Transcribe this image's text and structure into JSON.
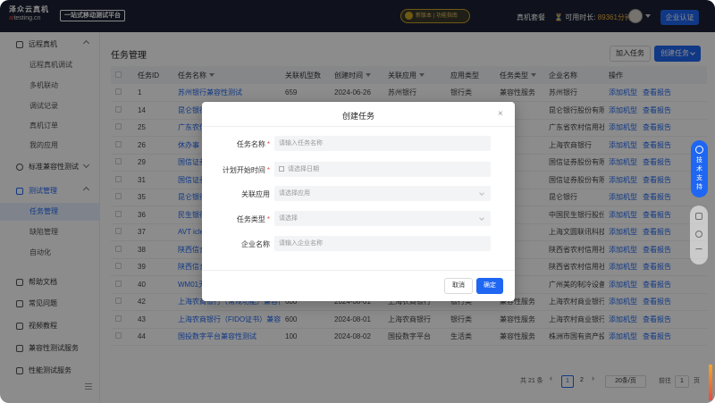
{
  "header": {
    "logo_line1": "泽众云真机",
    "logo_line2_prefix": "ai",
    "logo_line2_rest": "testing.cn",
    "platform_tag": "一站式移动测试平台",
    "notice_label": "新版本 | 功能指南",
    "real_machine_package": "真机套餐",
    "available_label": "可用时长:",
    "available_value": "89361分钟",
    "enterprise_button": "企业认证"
  },
  "sidebar": {
    "items": [
      {
        "label": "远程真机",
        "type": "parent",
        "expanded": true
      },
      {
        "label": "远程真机调试",
        "type": "child"
      },
      {
        "label": "多机联动",
        "type": "child"
      },
      {
        "label": "调试记录",
        "type": "child"
      },
      {
        "label": "真机订单",
        "type": "child"
      },
      {
        "label": "我的应用",
        "type": "child"
      },
      {
        "label": "标准兼容性测试",
        "type": "parent",
        "expanded": false
      },
      {
        "label": "测试管理",
        "type": "parent",
        "expanded": true,
        "active": true
      },
      {
        "label": "任务管理",
        "type": "child",
        "active": true
      },
      {
        "label": "缺陷管理",
        "type": "child"
      },
      {
        "label": "自动化",
        "type": "child"
      },
      {
        "label": "帮助文档",
        "type": "parent"
      },
      {
        "label": "常见问题",
        "type": "parent"
      },
      {
        "label": "视频教程",
        "type": "parent"
      },
      {
        "label": "兼容性测试服务",
        "type": "parent"
      },
      {
        "label": "性能测试服务",
        "type": "parent"
      }
    ]
  },
  "main": {
    "title": "任务管理",
    "add_task_button": "加入任务",
    "create_task_button": "创建任务",
    "table": {
      "headers": [
        "任务ID",
        "任务名称",
        "关联机型数",
        "创建时间",
        "关联应用",
        "应用类型",
        "任务类型",
        "企业名称",
        "操作"
      ],
      "rows": [
        [
          "1",
          "苏州银行兼容性测试",
          "659",
          "2024-06-26",
          "苏州银行",
          "银行类",
          "兼容性服务",
          "苏州银行"
        ],
        [
          "14",
          "昆仑银行",
          "",
          "",
          "",
          "",
          "",
          "昆仑银行股份有限公"
        ],
        [
          "25",
          "广东农信",
          "",
          "",
          "",
          "",
          "",
          "广东省农村信用社"
        ],
        [
          "26",
          "休办事",
          "",
          "",
          "",
          "",
          "",
          "上海农商银行"
        ],
        [
          "29",
          "国信证券",
          "",
          "",
          "",
          "",
          "",
          "国信证券股份有限公"
        ],
        [
          "31",
          "国信证券",
          "",
          "",
          "",
          "",
          "",
          "国信证券股份有限公"
        ],
        [
          "35",
          "昆仑银行",
          "",
          "",
          "",
          "",
          "",
          "昆仑银行"
        ],
        [
          "36",
          "民生银行",
          "",
          "",
          "",
          "",
          "",
          "中国民生银行股份有"
        ],
        [
          "37",
          "AVT iclea",
          "",
          "",
          "",
          "",
          "",
          "上海文圆联讯科技有"
        ],
        [
          "38",
          "陕西信合",
          "",
          "",
          "",
          "",
          "",
          "陕西省农村信用社联"
        ],
        [
          "39",
          "陕西信合",
          "",
          "",
          "",
          "",
          "",
          "陕西省农村信用社联"
        ],
        [
          "40",
          "WM01无",
          "",
          "",
          "",
          "",
          "",
          "广州美的制冷设备有"
        ],
        [
          "42",
          "上海农商银行（常规功能）兼容性测试",
          "600",
          "2024-08-01",
          "上海农商银行",
          "银行类",
          "兼容性服务",
          "上海农村商业银行"
        ],
        [
          "43",
          "上海农商银行（FIDO证书）兼容性测试",
          "600",
          "2024-08-01",
          "上海农商银行",
          "银行类",
          "兼容性服务",
          "上海农村商业银行"
        ],
        [
          "44",
          "国投数字平台兼容性测试",
          "100",
          "2024-08-02",
          "国投数字平台",
          "生活类",
          "兼容性服务",
          "株洲市国有资产投资"
        ]
      ],
      "actions": [
        "添加机型",
        "查看报告"
      ]
    },
    "pagination": {
      "total": "共 21 条",
      "prev": "‹",
      "pages": [
        "1",
        "2"
      ],
      "next": "›",
      "page_size": "20条/页",
      "goto_label": "前往",
      "goto_value": "1",
      "page_unit": "页"
    }
  },
  "float": {
    "help_label": "技术支持"
  },
  "modal": {
    "title": "创建任务",
    "close": "×",
    "fields": [
      {
        "label": "任务名称",
        "required": true,
        "placeholder": "请输入任务名称"
      },
      {
        "label": "计划开始时间",
        "required": true,
        "placeholder": "请选择日期"
      },
      {
        "label": "关联应用",
        "required": false,
        "placeholder": "请选择应用"
      },
      {
        "label": "任务类型",
        "required": true,
        "placeholder": "请选择"
      },
      {
        "label": "企业名称",
        "required": false,
        "placeholder": "请输入企业名称"
      }
    ],
    "cancel": "取消",
    "confirm": "确定"
  },
  "colors": {
    "accent": "#1f67f2",
    "header_bg": "#1c2233",
    "available_highlight": "#f0b23c"
  }
}
